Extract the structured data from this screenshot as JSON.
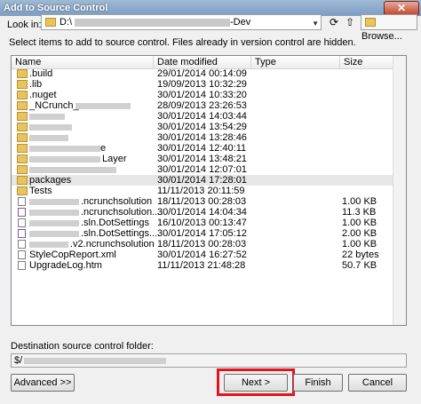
{
  "window": {
    "title": "Add to Source Control",
    "close_symbol": "✕"
  },
  "lookin": {
    "label": "Look in:",
    "path_prefix": "D:\\",
    "path_suffix": "-Dev",
    "browse_label": "Browse..."
  },
  "instructions": "Select items to add to source control. Files already in version control are hidden.",
  "columns": [
    "Name",
    "Date modified",
    "Type",
    "Size"
  ],
  "rows": [
    {
      "name": ".build",
      "date": "29/01/2014 00:14:09",
      "size": "",
      "icon": "folder"
    },
    {
      "name": ".lib",
      "date": "19/09/2013 10:32:29",
      "size": "",
      "icon": "folder"
    },
    {
      "name": ".nuget",
      "date": "30/01/2014 10:33:20",
      "size": "",
      "icon": "folder"
    },
    {
      "name": "_NCrunch_",
      "date": "28/09/2013 23:26:53",
      "size": "",
      "icon": "folder"
    },
    {
      "name": "",
      "date": "30/01/2014 14:03:44",
      "size": "",
      "icon": "folder"
    },
    {
      "name": "",
      "date": "30/01/2014 13:54:29",
      "size": "",
      "icon": "folder"
    },
    {
      "name": "",
      "date": "30/01/2014 13:28:46",
      "size": "",
      "icon": "folder"
    },
    {
      "name": "e",
      "date": "30/01/2014 12:40:11",
      "size": "",
      "icon": "folder"
    },
    {
      "name": "Layer",
      "date": "30/01/2014 13:48:21",
      "size": "",
      "icon": "folder"
    },
    {
      "name": "",
      "date": "30/01/2014 12:07:01",
      "size": "",
      "icon": "folder"
    },
    {
      "name": "packages",
      "date": "30/01/2014 17:28:01",
      "size": "",
      "icon": "folder"
    },
    {
      "name": "Tests",
      "date": "11/11/2013 20:11:59",
      "size": "",
      "icon": "folder"
    },
    {
      "name": ".ncrunchsolution",
      "date": "18/11/2013 00:28:03",
      "size": "1.00 KB",
      "icon": "file"
    },
    {
      "name": ".ncrunchsolution....",
      "date": "30/01/2014 14:04:34",
      "size": "11.3 KB",
      "icon": "sln"
    },
    {
      "name": ".sln.DotSettings",
      "date": "16/10/2013 00:13:47",
      "size": "1.00 KB",
      "icon": "file"
    },
    {
      "name": ".sln.DotSettings....",
      "date": "30/01/2014 17:05:12",
      "size": "2.00 KB",
      "icon": "sln"
    },
    {
      "name": ".v2.ncrunchsolution",
      "date": "18/11/2013 00:28:03",
      "size": "1.00 KB",
      "icon": "file"
    },
    {
      "name": "StyleCopReport.xml",
      "date": "30/01/2014 16:27:52",
      "size": "22 bytes",
      "icon": "file"
    },
    {
      "name": "UpgradeLog.htm",
      "date": "11/11/2013 21:48:28",
      "size": "50.7 KB",
      "icon": "file"
    }
  ],
  "destination": {
    "label": "Destination source control folder:",
    "value": "$/"
  },
  "buttons": {
    "advanced": "Advanced >>",
    "next": "Next >",
    "finish": "Finish",
    "cancel": "Cancel"
  }
}
